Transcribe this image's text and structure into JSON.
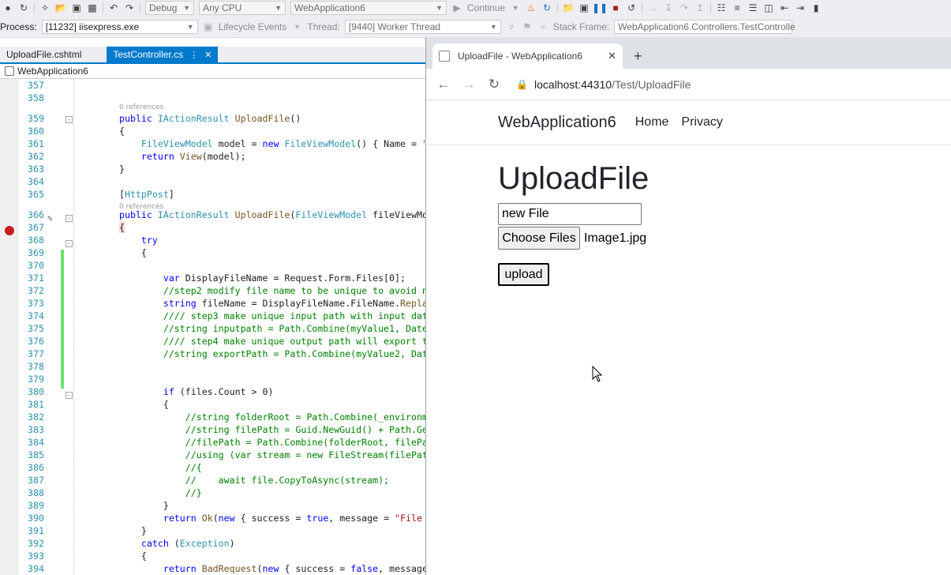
{
  "toolbar": {
    "config": "Debug",
    "platform": "Any CPU",
    "startup_project": "WebApplication6",
    "continue_label": "Continue"
  },
  "debug_bar": {
    "process_label": "Process:",
    "process_value": "[11232] iisexpress.exe",
    "lifecycle_label": "Lifecycle Events",
    "thread_label": "Thread:",
    "thread_value": "[9440] Worker Thread",
    "stack_label": "Stack Frame:",
    "stack_value": "WebApplication6.Controllers.TestControlle"
  },
  "doc_tabs": [
    "UploadFile.cshtml",
    "TestController.cs"
  ],
  "nav_project": "WebApplication6",
  "code": {
    "refs": "0 references",
    "lines": [
      {
        "n": "357",
        "t": ""
      },
      {
        "n": "358",
        "t": ""
      },
      {
        "n": "359",
        "t": "public IActionResult UploadFile()"
      },
      {
        "n": "360",
        "t": "{"
      },
      {
        "n": "361",
        "t": "    FileViewModel model = new FileViewModel() { Name = \""
      },
      {
        "n": "362",
        "t": "    return View(model);"
      },
      {
        "n": "363",
        "t": "}"
      },
      {
        "n": "364",
        "t": ""
      },
      {
        "n": "365",
        "t": "[HttpPost]"
      },
      {
        "n": "366",
        "t": "public IActionResult UploadFile(FileViewModel fileViewMo"
      },
      {
        "n": "367",
        "t": "{"
      },
      {
        "n": "368",
        "t": "    try"
      },
      {
        "n": "369",
        "t": "    {"
      },
      {
        "n": "370",
        "t": ""
      },
      {
        "n": "371",
        "t": "        var DisplayFileName = Request.Form.Files[0];"
      },
      {
        "n": "372",
        "t": "        //step2 modify file name to be unique to avoid n"
      },
      {
        "n": "373",
        "t": "        string fileName = DisplayFileName.FileName.Repla"
      },
      {
        "n": "374",
        "t": "        //// step3 make unique input path with input dat"
      },
      {
        "n": "375",
        "t": "        //string inputpath = Path.Combine(myValue1, Date"
      },
      {
        "n": "376",
        "t": "        //// step4 make unique output path will export t"
      },
      {
        "n": "377",
        "t": "        //string exportPath = Path.Combine(myValue2, Dat"
      },
      {
        "n": "378",
        "t": ""
      },
      {
        "n": "379",
        "t": ""
      },
      {
        "n": "380",
        "t": "        if (files.Count > 0)"
      },
      {
        "n": "381",
        "t": "        {"
      },
      {
        "n": "382",
        "t": "            //string folderRoot = Path.Combine(_environm"
      },
      {
        "n": "383",
        "t": "            //string filePath = Guid.NewGuid() + Path.Ge"
      },
      {
        "n": "384",
        "t": "            //filePath = Path.Combine(folderRoot, filePa"
      },
      {
        "n": "385",
        "t": "            //using (var stream = new FileStream(filePat"
      },
      {
        "n": "386",
        "t": "            //{"
      },
      {
        "n": "387",
        "t": "            //    await file.CopyToAsync(stream);"
      },
      {
        "n": "388",
        "t": "            //}"
      },
      {
        "n": "389",
        "t": "        }"
      },
      {
        "n": "390",
        "t": "        return Ok(new { success = true, message = \"File"
      },
      {
        "n": "391",
        "t": "    }"
      },
      {
        "n": "392",
        "t": "    catch (Exception)"
      },
      {
        "n": "393",
        "t": "    {"
      },
      {
        "n": "394",
        "t": "        return BadRequest(new { success = false, message"
      }
    ]
  },
  "browser": {
    "tab_title": "UploadFile - WebApplication6",
    "url_host": "localhost:44310",
    "url_path": "/Test/UploadFile",
    "brand": "WebApplication6",
    "nav": [
      "Home",
      "Privacy"
    ],
    "heading": "UploadFile",
    "name_value": "new File",
    "choose_files": "Choose Files",
    "chosen_file": "Image1.jpg",
    "upload": "upload"
  }
}
